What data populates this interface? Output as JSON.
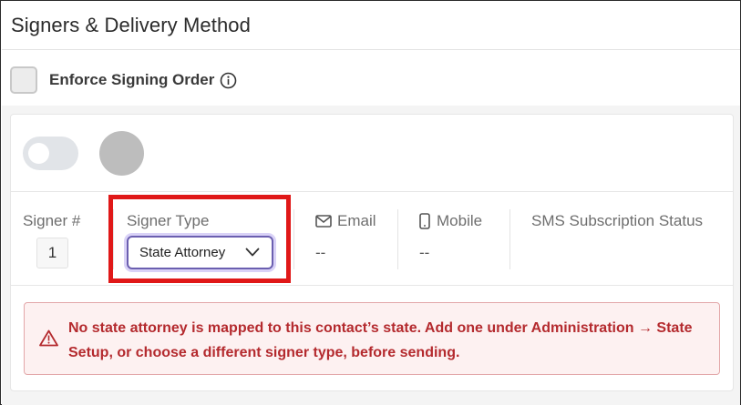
{
  "header": {
    "title": "Signers & Delivery Method"
  },
  "enforce": {
    "label": "Enforce Signing Order",
    "checked": false
  },
  "columns": {
    "signer_num": "Signer #",
    "signer_type": "Signer Type",
    "email": "Email",
    "mobile": "Mobile",
    "sms": "SMS Subscription Status"
  },
  "signer": {
    "number": "1",
    "type": "State Attorney",
    "email": "--",
    "mobile": "--"
  },
  "alert": {
    "message": "No state attorney is mapped to this contact’s state. Add one under Administration → State Setup, or choose a different signer type, before sending."
  },
  "colors": {
    "error": "#b42a2e",
    "select_border": "#6b5fb0",
    "highlight": "#e01818"
  },
  "icons": [
    "info-icon",
    "envelope-icon",
    "phone-icon",
    "chevron-down-icon",
    "warning-icon"
  ]
}
